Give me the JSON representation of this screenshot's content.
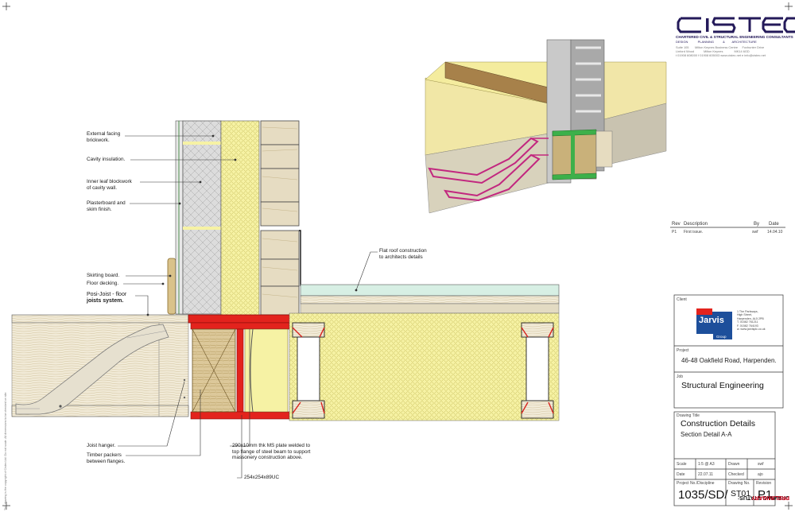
{
  "labels": {
    "external_facing": [
      "External facing",
      "brickwork."
    ],
    "cavity_insulation": "Cavity insulation.",
    "inner_leaf": [
      "Inner leaf blockwork",
      "of cavity wall."
    ],
    "plasterboard": [
      "Plasterboard and",
      "skim finish."
    ],
    "skirting": "Skirting board.",
    "floor_decking": "Floor decking.",
    "posi_joist": [
      "Posi-Joist - floor",
      "joists system."
    ],
    "flat_roof": [
      "Flat roof construction",
      "to architects details"
    ],
    "joist_hanger": "Joist hanger.",
    "timber_packers": [
      "Timber packers",
      "between flanges."
    ],
    "ms_plate": [
      "290x10mm thk MS plate welded to",
      "top flange of steel beam to support",
      "massonery construction above."
    ],
    "ucol": "254x254x89UC"
  },
  "logo": {
    "name": "CISTEC",
    "tagline": "CHARTERED CIVIL & STRUCTURAL ENGINEERING CONSULTANTS",
    "sub": [
      "DESIGN",
      "PLANNING",
      "&",
      "ARCHITECTURE"
    ],
    "address_cols": [
      "Suite 105",
      "Milton Keynes Business Centre",
      "Foxhunter Drive"
    ],
    "address_cols2": [
      "Linford Wood",
      "Milton Keynes",
      "MK14 6GD"
    ],
    "contact": "t 01908 608000  f 01908 605003  www.cistec.net  e info@cistec.net"
  },
  "revisions": {
    "headers": [
      "Rev",
      "Description",
      "By",
      "Date"
    ],
    "rows": [
      [
        "P1",
        "First issue.",
        "swf",
        "14.04.10"
      ]
    ]
  },
  "client": {
    "label": "Client",
    "logo_text": "Jarvis",
    "logo_sub": "Group",
    "address": [
      "1 The Parkways,",
      "High Street,",
      "Harpenden, AL5 2PB",
      "T. 01582 761211",
      "F. 01582 764193",
      "w. www.jarvisplc.co.uk"
    ]
  },
  "project": {
    "label": "Project",
    "value": "46-48 Oakfield Road, Harpenden."
  },
  "job": {
    "label": "Job",
    "value": "Structural Engineering"
  },
  "drawing": {
    "title_label": "Drawing Title",
    "title": "Construction Details",
    "subtitle": "Section Detail A-A",
    "scale_label": "Scale",
    "scale": "1:5 @ A3",
    "drawn_label": "Drawn",
    "drawn": "swf",
    "date_label": "Date",
    "date": "22.07.11",
    "checked_label": "Checked",
    "checked": "ajo",
    "projno_label": "Project No./Discipline",
    "projno": "1035/SD/",
    "drawno_label": "Drawing No.",
    "drawno": "ST01",
    "revision_label": "Revision",
    "revision": "P1"
  },
  "status": {
    "label": "DRAWING STATUS:",
    "value": "PRELIMINARY"
  },
  "side_note": "This drawing is the copyright of Cistec Ltd. Do not scale. All dimensions to be checked on site.",
  "colors": {
    "steel": "#e3231d",
    "insulation": "#f3ef9a",
    "timber": "#d9c79a",
    "posi": "#d65a9a",
    "roof": "#bfe5d6"
  }
}
